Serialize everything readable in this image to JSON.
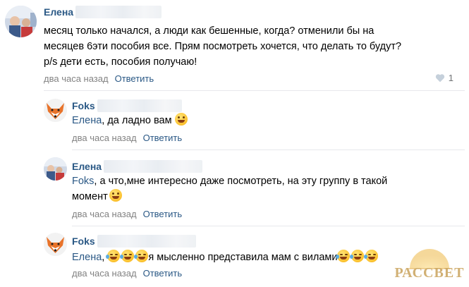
{
  "comments": [
    {
      "author": "Елена",
      "lines": [
        "месяц только начался, а люди как бешенные, когда? отменили бы на",
        "месяцев 6эти пособия все. Прям посмотреть хочется, что делать то будут?",
        "p/s дети есть, пособия получаю!"
      ],
      "time": "два часа назад",
      "reply_label": "Ответить",
      "likes": "1"
    },
    {
      "author": "Foks",
      "mention": "Елена",
      "text": ", да ладно вам",
      "time": "два часа назад",
      "reply_label": "Ответить"
    },
    {
      "author": "Елена",
      "mention": "Foks",
      "line1": ", а что,мне интересно даже посмотреть, на эту группу в такой",
      "line2": "момент",
      "time": "два часа назад",
      "reply_label": "Ответить"
    },
    {
      "author": "Foks",
      "mention": "Елена",
      "prefix": ",",
      "text": "я мысленно представила мам с вилами",
      "time": "два часа назад",
      "reply_label": "Ответить"
    }
  ],
  "watermark": "РАССВЕТ",
  "colors": {
    "link": "#2a5885",
    "meta": "#828282",
    "divider": "#e7e8ec"
  }
}
